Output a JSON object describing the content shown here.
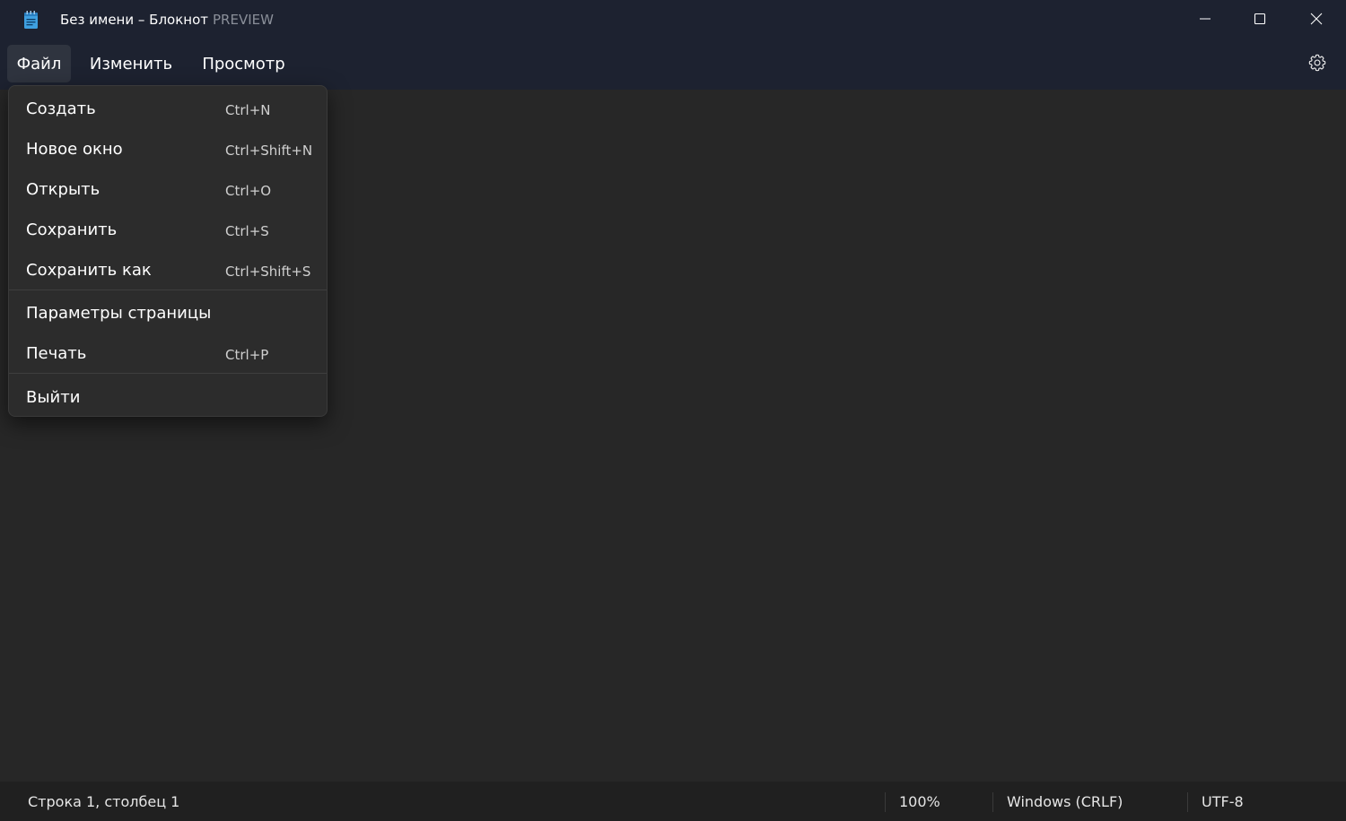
{
  "window": {
    "title": "Без имени – Блокнот",
    "preview_tag": "PREVIEW"
  },
  "menubar": {
    "file": "Файл",
    "edit": "Изменить",
    "view": "Просмотр"
  },
  "file_menu": {
    "items": [
      {
        "label": "Создать",
        "shortcut": "Ctrl+N"
      },
      {
        "label": "Новое окно",
        "shortcut": "Ctrl+Shift+N"
      },
      {
        "label": "Открыть",
        "shortcut": "Ctrl+O"
      },
      {
        "label": "Сохранить",
        "shortcut": "Ctrl+S"
      },
      {
        "label": "Сохранить как",
        "shortcut": "Ctrl+Shift+S"
      },
      {
        "label": "Параметры страницы",
        "shortcut": ""
      },
      {
        "label": "Печать",
        "shortcut": "Ctrl+P"
      },
      {
        "label": "Выйти",
        "shortcut": ""
      }
    ]
  },
  "statusbar": {
    "position": "Строка 1, столбец 1",
    "zoom": "100%",
    "line_ending": "Windows (CRLF)",
    "encoding": "UTF-8"
  },
  "icons": {
    "app": "notepad-icon",
    "minimize": "minimize-icon",
    "maximize": "maximize-icon",
    "close": "close-icon",
    "settings": "gear-icon"
  },
  "colors": {
    "titlebar": "#1d2230",
    "editor": "#272727",
    "menu_bg": "#2c2c2c",
    "statusbar": "#202020"
  }
}
